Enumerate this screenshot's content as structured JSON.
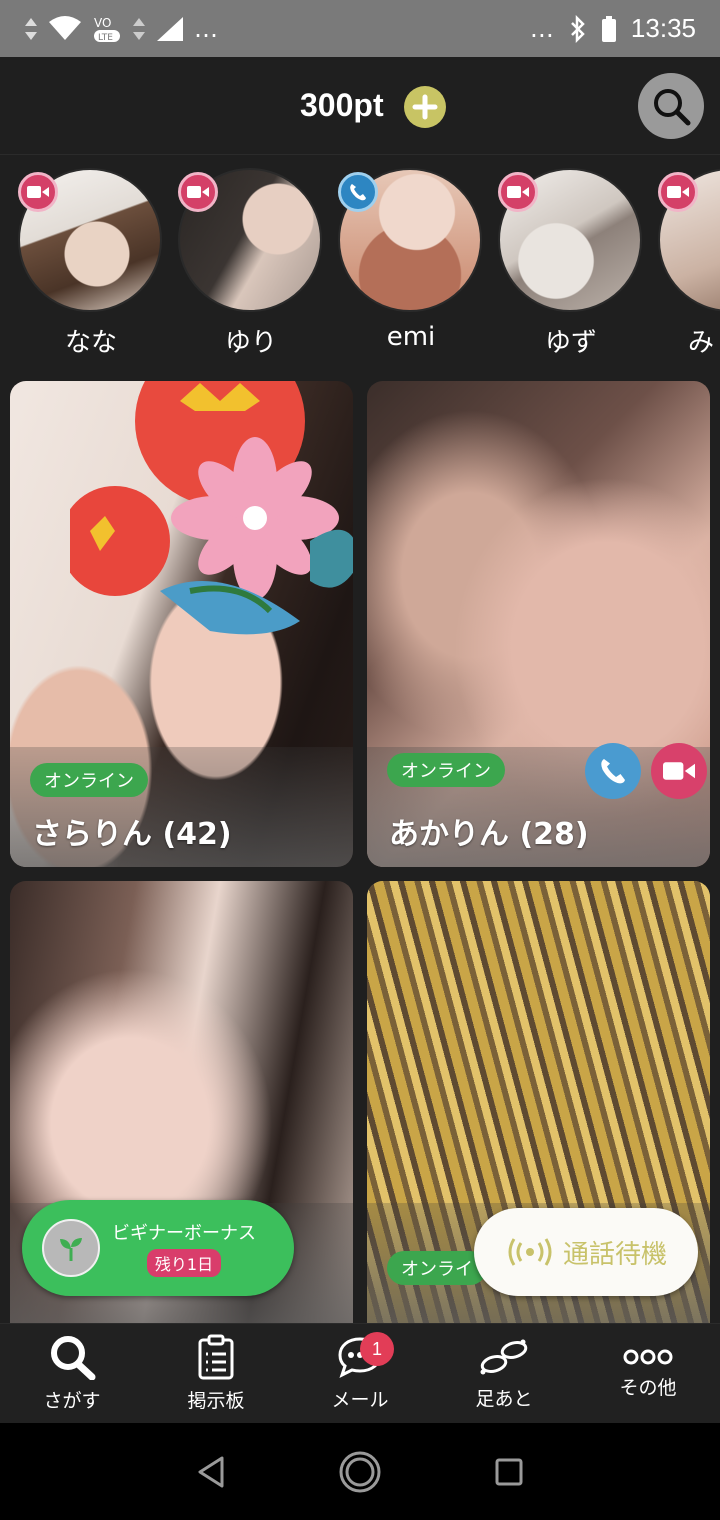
{
  "status_bar": {
    "time": "13:35",
    "left_more": "…",
    "right_more": "…"
  },
  "header": {
    "points": "300pt"
  },
  "stories": [
    {
      "name": "なな",
      "badge": "video-icon"
    },
    {
      "name": "ゆり",
      "badge": "video-icon"
    },
    {
      "name": "emi",
      "badge": "phone-icon"
    },
    {
      "name": "ゆず",
      "badge": "video-icon"
    },
    {
      "name": "み",
      "badge": "video-icon"
    }
  ],
  "cards": [
    {
      "status": "オンライン",
      "name": "さらりん (42)"
    },
    {
      "status": "オンライン",
      "name": "あかりん (28)"
    },
    {
      "status": "",
      "name": ""
    },
    {
      "status": "オンライ",
      "name": ""
    }
  ],
  "bonus": {
    "title": "ビギナーボーナス",
    "remaining": "残り1日"
  },
  "standby": {
    "label": "通話待機"
  },
  "bottom_nav": [
    {
      "label": "さがす",
      "icon": "search-icon"
    },
    {
      "label": "掲示板",
      "icon": "clipboard-icon"
    },
    {
      "label": "メール",
      "icon": "chat-icon",
      "badge": "1"
    },
    {
      "label": "足あと",
      "icon": "footprints-icon"
    },
    {
      "label": "その他",
      "icon": "more-icon"
    }
  ],
  "colors": {
    "background": "#1f1f1f",
    "accent_gold": "#c8c464",
    "online_green": "#3ca64e",
    "video_pink": "#d44068",
    "call_blue": "#2d86c2",
    "badge_red": "#e23d57"
  }
}
